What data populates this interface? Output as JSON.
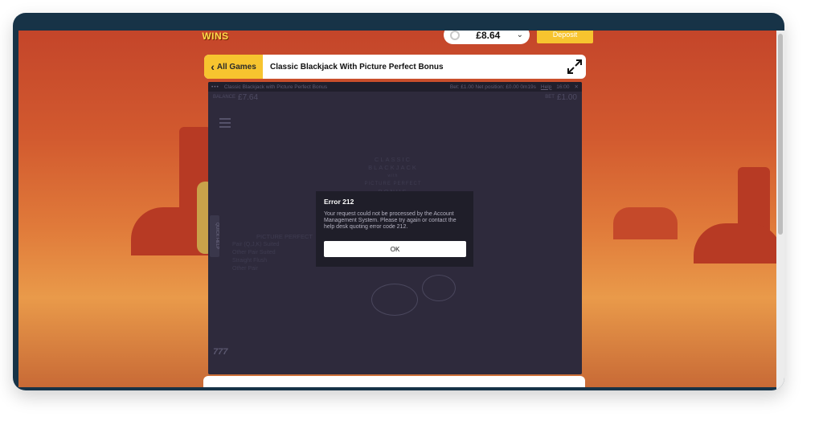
{
  "site": {
    "logo_text": "WINS",
    "balance": "£8.64",
    "deposit_label": "Deposit"
  },
  "game_bar": {
    "back_label": "All Games",
    "title": "Classic Blackjack With Picture Perfect Bonus"
  },
  "game": {
    "window_title": "Classic Blackjack with Picture Perfect Bonus",
    "status": "Bet: £1.00  Net position: £0.00  0m19s",
    "help_label": "Help",
    "clock": "16:00",
    "balance_label": "BALANCE",
    "balance_value": "£7.64",
    "bet_label": "BET",
    "bet_value": "£1.00",
    "logo_lines": [
      "CLASSIC",
      "BLACKJACK",
      "with",
      "PICTURE PERFECT",
      "BONUS"
    ],
    "quick_help": "QUICK HELP",
    "paytable_title": "PICTURE PERFECT",
    "paytable_rows": [
      "Pair (Q,J,K) Suited",
      "Other Pair Suited",
      "Straight Flush",
      "Other Pair"
    ],
    "bottom_icon": "777"
  },
  "dialog": {
    "title": "Error 212",
    "message": "Your request could not be processed by the Account Management System. Please try again or contact the help desk quoting error code 212.",
    "ok_label": "OK"
  }
}
